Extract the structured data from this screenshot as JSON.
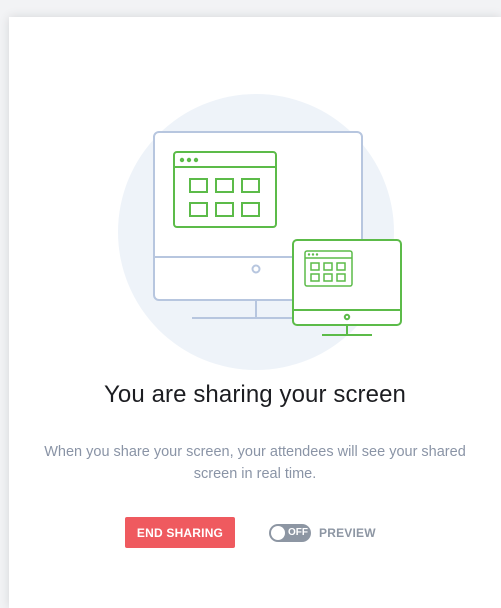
{
  "dialog": {
    "title": "You are sharing your screen",
    "description": "When you share your screen, your attendees will see your shared screen in real time.",
    "end_button_label": "END SHARING",
    "preview_toggle": {
      "state_label": "OFF",
      "label": "PREVIEW",
      "on": false
    }
  },
  "illustration": {
    "icon": "screen-share-illustration",
    "colors": {
      "circle": "#eef3f9",
      "monitor_outline": "#b7c6df",
      "accent": "#5cbb49"
    }
  },
  "colors": {
    "end_button": "#ef5a5f",
    "title": "#1c1d21",
    "description": "#8a94a6",
    "toggle": "#8d96a3"
  }
}
